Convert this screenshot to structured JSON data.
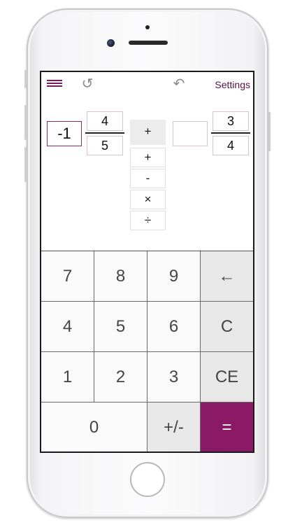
{
  "topbar": {
    "menu_icon": "hamburger-menu-icon",
    "refresh_icon": "↺",
    "undo_icon": "↶",
    "settings_label": "Settings"
  },
  "left_fraction": {
    "whole": "-1",
    "numerator": "4",
    "denominator": "5"
  },
  "right_fraction": {
    "whole": "",
    "numerator": "3",
    "denominator": "4"
  },
  "operator": {
    "selected": "+",
    "options": [
      "+",
      "-",
      "×",
      "÷"
    ]
  },
  "keypad": {
    "k7": "7",
    "k8": "8",
    "k9": "9",
    "back": "←",
    "k4": "4",
    "k5": "5",
    "k6": "6",
    "clear": "C",
    "k1": "1",
    "k2": "2",
    "k3": "3",
    "clear_entry": "CE",
    "k0": "0",
    "sign": "+/-",
    "equals": "="
  },
  "colors": {
    "accent": "#8a1a66",
    "settings_text": "#5b1047"
  }
}
